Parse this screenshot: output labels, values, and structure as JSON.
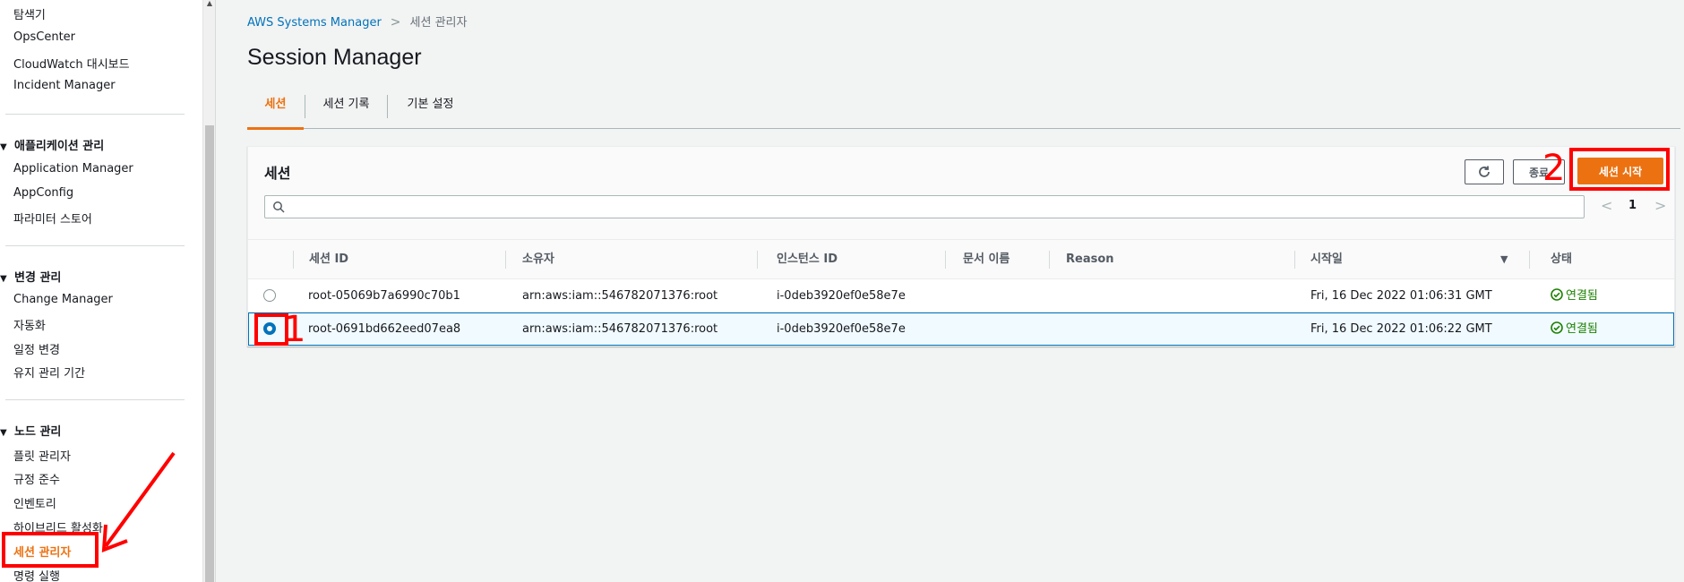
{
  "sidebar": {
    "items_top": [
      {
        "label": "탐색기"
      },
      {
        "label": "OpsCenter"
      },
      {
        "label": "CloudWatch 대시보드"
      },
      {
        "label": "Incident Manager"
      }
    ],
    "section_app": {
      "title": "애플리케이션 관리",
      "items": [
        {
          "label": "Application Manager"
        },
        {
          "label": "AppConfig"
        },
        {
          "label": "파라미터 스토어"
        }
      ]
    },
    "section_change": {
      "title": "변경 관리",
      "items": [
        {
          "label": "Change Manager"
        },
        {
          "label": "자동화"
        },
        {
          "label": "일정 변경"
        },
        {
          "label": "유지 관리 기간"
        }
      ]
    },
    "section_node": {
      "title": "노드 관리",
      "items": [
        {
          "label": "플릿 관리자"
        },
        {
          "label": "규정 준수"
        },
        {
          "label": "인벤토리"
        },
        {
          "label": "하이브리드 활성화"
        },
        {
          "label": "세션 관리자",
          "active": true
        },
        {
          "label": "명령 실행"
        }
      ]
    }
  },
  "breadcrumb": {
    "parent": "AWS Systems Manager",
    "separator": ">",
    "current": "세션 관리자"
  },
  "page": {
    "title": "Session Manager"
  },
  "tabs": [
    {
      "label": "세션",
      "active": true
    },
    {
      "label": "세션 기록"
    },
    {
      "label": "기본 설정"
    }
  ],
  "panel": {
    "title": "세션",
    "terminate_label": "종료",
    "start_label": "세션 시작",
    "search_placeholder": "",
    "pager": {
      "prev": "<",
      "page": "1",
      "next": ">"
    }
  },
  "table": {
    "columns": {
      "session_id": "세션 ID",
      "owner": "소유자",
      "instance_id": "인스턴스 ID",
      "document": "문서 이름",
      "reason": "Reason",
      "start_date": "시작일",
      "status": "상태"
    },
    "rows": [
      {
        "session_id": "root-05069b7a6990c70b1",
        "owner": "arn:aws:iam::546782071376:root",
        "instance_id": "i-0deb3920ef0e58e7e",
        "document": "",
        "reason": "",
        "start_date": "Fri, 16 Dec 2022 01:06:31 GMT",
        "status": "연결됨",
        "selected": false
      },
      {
        "session_id": "root-0691bd662eed07ea8",
        "owner": "arn:aws:iam::546782071376:root",
        "instance_id": "i-0deb3920ef0e58e7e",
        "document": "",
        "reason": "",
        "start_date": "Fri, 16 Dec 2022 01:06:22 GMT",
        "status": "연결됨",
        "selected": true
      }
    ]
  },
  "annotations": {
    "step1": "1",
    "step2": "2"
  },
  "colors": {
    "accent": "#ec7211",
    "link": "#0073bb",
    "success": "#1d8102",
    "annotation": "#ff0000"
  }
}
